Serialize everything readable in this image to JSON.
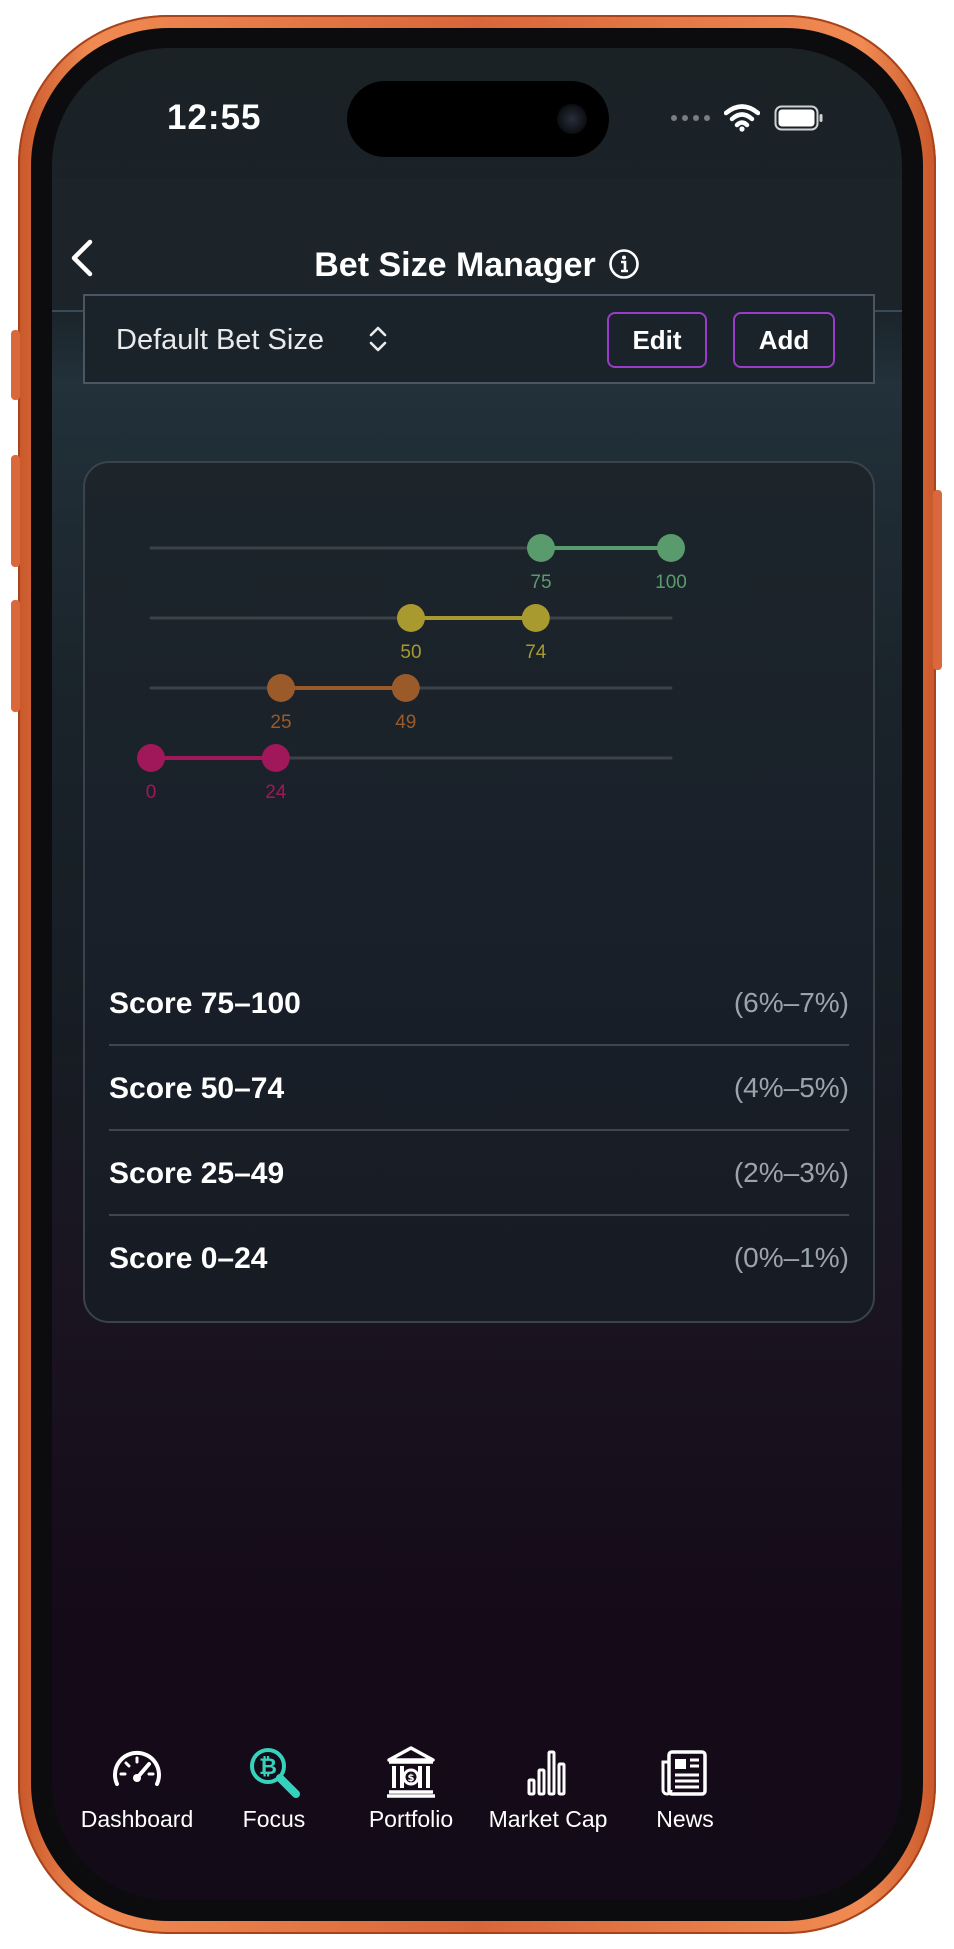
{
  "status": {
    "time": "12:55"
  },
  "header": {
    "title": "Bet Size Manager"
  },
  "selector": {
    "value": "Default Bet Size",
    "edit_label": "Edit",
    "add_label": "Add"
  },
  "colors": {
    "accent_button": "#9a3cc8",
    "tab_active": "#35d2bd"
  },
  "ranges": [
    {
      "label": "Score 75–100",
      "range": "(6%–7%)",
      "start": 75,
      "end": 100,
      "start_label": "75",
      "end_label": "100",
      "color": "#5a9b6e"
    },
    {
      "label": "Score 50–74",
      "range": "(4%–5%)",
      "start": 50,
      "end": 74,
      "start_label": "50",
      "end_label": "74",
      "color": "#a89a2e"
    },
    {
      "label": "Score 25–49",
      "range": "(2%–3%)",
      "start": 25,
      "end": 49,
      "start_label": "25",
      "end_label": "49",
      "color": "#9a5a2a"
    },
    {
      "label": "Score 0–24",
      "range": "(0%–1%)",
      "start": 0,
      "end": 24,
      "start_label": "0",
      "end_label": "24",
      "color": "#a0185a"
    }
  ],
  "tabs": [
    {
      "label": "Dashboard",
      "icon": "speedometer-icon"
    },
    {
      "label": "Focus",
      "icon": "bitcoin-search-icon",
      "active": true
    },
    {
      "label": "Portfolio",
      "icon": "bank-icon"
    },
    {
      "label": "Market Cap",
      "icon": "bar-chart-icon"
    },
    {
      "label": "News",
      "icon": "newspaper-icon"
    }
  ]
}
